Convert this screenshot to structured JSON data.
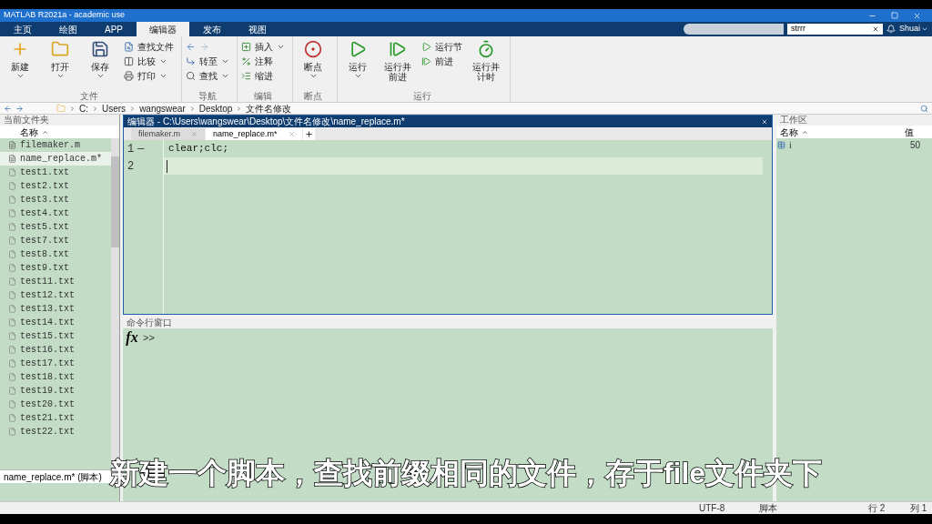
{
  "window": {
    "title": "MATLAB R2021a - academic use"
  },
  "ribbon_tabs": [
    {
      "label": "主页",
      "selected": false
    },
    {
      "label": "绘图",
      "selected": false
    },
    {
      "label": "APP",
      "selected": false
    },
    {
      "label": "编辑器",
      "selected": true
    },
    {
      "label": "发布",
      "selected": false
    },
    {
      "label": "视图",
      "selected": false
    }
  ],
  "search": {
    "value": "strrr"
  },
  "user": "Shuai",
  "ribbon_groups": [
    {
      "label": "文件",
      "items": [
        {
          "kind": "large",
          "label": "新建",
          "dropdown": true
        },
        {
          "kind": "large",
          "label": "打开",
          "dropdown": true
        },
        {
          "kind": "large",
          "label": "保存",
          "dropdown": true
        },
        {
          "kind": "stack",
          "rows": [
            {
              "label": "查找文件",
              "dropdown": false
            },
            {
              "label": "比较",
              "dropdown": true
            },
            {
              "label": "打印",
              "dropdown": true
            }
          ]
        }
      ]
    },
    {
      "label": "导航",
      "items": [
        {
          "kind": "stack",
          "rows": [
            {
              "kind": "arrows"
            },
            {
              "label": "转至",
              "dropdown": true
            },
            {
              "label": "查找",
              "dropdown": true
            }
          ]
        }
      ]
    },
    {
      "label": "编辑",
      "items": [
        {
          "kind": "stack",
          "rows": [
            {
              "label": "插入",
              "dropdown": true
            },
            {
              "label": "注释",
              "dropdown": false
            },
            {
              "label": "缩进",
              "dropdown": false
            }
          ]
        }
      ]
    },
    {
      "label": "断点",
      "items": [
        {
          "kind": "large",
          "label": "断点",
          "dropdown": true
        }
      ]
    },
    {
      "label": "运行",
      "items": [
        {
          "kind": "large",
          "label": "运行",
          "dropdown": true
        },
        {
          "kind": "large",
          "label": "运行并前进",
          "dropdown": false
        },
        {
          "kind": "stack",
          "rows": [
            {
              "label": "运行节",
              "dropdown": false
            },
            {
              "label": "前进",
              "dropdown": false
            }
          ]
        },
        {
          "kind": "large",
          "label": "运行并计时",
          "dropdown": false
        }
      ]
    }
  ],
  "address_path": [
    "C:",
    "Users",
    "wangswear",
    "Desktop",
    "文件名修改"
  ],
  "current_folder": {
    "title": "当前文件夹",
    "column": "名称",
    "details": "name_replace.m* (脚本)",
    "files": [
      {
        "name": "filemaker.m",
        "kind": "script",
        "selected": false
      },
      {
        "name": "name_replace.m*",
        "kind": "script",
        "selected": true
      },
      {
        "name": "test1.txt",
        "kind": "text",
        "selected": false
      },
      {
        "name": "test2.txt",
        "kind": "text",
        "selected": false
      },
      {
        "name": "test3.txt",
        "kind": "text",
        "selected": false
      },
      {
        "name": "test4.txt",
        "kind": "text",
        "selected": false
      },
      {
        "name": "test5.txt",
        "kind": "text",
        "selected": false
      },
      {
        "name": "test7.txt",
        "kind": "text",
        "selected": false
      },
      {
        "name": "test8.txt",
        "kind": "text",
        "selected": false
      },
      {
        "name": "test9.txt",
        "kind": "text",
        "selected": false
      },
      {
        "name": "test11.txt",
        "kind": "text",
        "selected": false
      },
      {
        "name": "test12.txt",
        "kind": "text",
        "selected": false
      },
      {
        "name": "test13.txt",
        "kind": "text",
        "selected": false
      },
      {
        "name": "test14.txt",
        "kind": "text",
        "selected": false
      },
      {
        "name": "test15.txt",
        "kind": "text",
        "selected": false
      },
      {
        "name": "test16.txt",
        "kind": "text",
        "selected": false
      },
      {
        "name": "test17.txt",
        "kind": "text",
        "selected": false
      },
      {
        "name": "test18.txt",
        "kind": "text",
        "selected": false
      },
      {
        "name": "test19.txt",
        "kind": "text",
        "selected": false
      },
      {
        "name": "test20.txt",
        "kind": "text",
        "selected": false
      },
      {
        "name": "test21.txt",
        "kind": "text",
        "selected": false
      },
      {
        "name": "test22.txt",
        "kind": "text",
        "selected": false
      }
    ]
  },
  "editor": {
    "title": "编辑器 - C:\\Users\\wangswear\\Desktop\\文件名修改\\name_replace.m*",
    "tabs": [
      {
        "label": "filemaker.m",
        "selected": false
      },
      {
        "label": "name_replace.m*",
        "selected": true
      }
    ],
    "lines": [
      {
        "number": "1",
        "marker": "—",
        "code": "clear;clc;",
        "selected": false
      },
      {
        "number": "2",
        "selected": true
      }
    ]
  },
  "command_window": {
    "title": "命令行窗口",
    "fx": "fx",
    "prompt": ">>"
  },
  "workspace": {
    "title": "工作区",
    "columns": [
      "名称",
      "值"
    ],
    "rows": [
      {
        "name": "i",
        "value": "50"
      }
    ]
  },
  "status_bar": {
    "encoding": "UTF-8",
    "file_type": "脚本",
    "line": "行 2",
    "column": "列 1"
  },
  "subtitle": "新建一个脚本，查找前缀相同的文件，存于file文件夹下"
}
